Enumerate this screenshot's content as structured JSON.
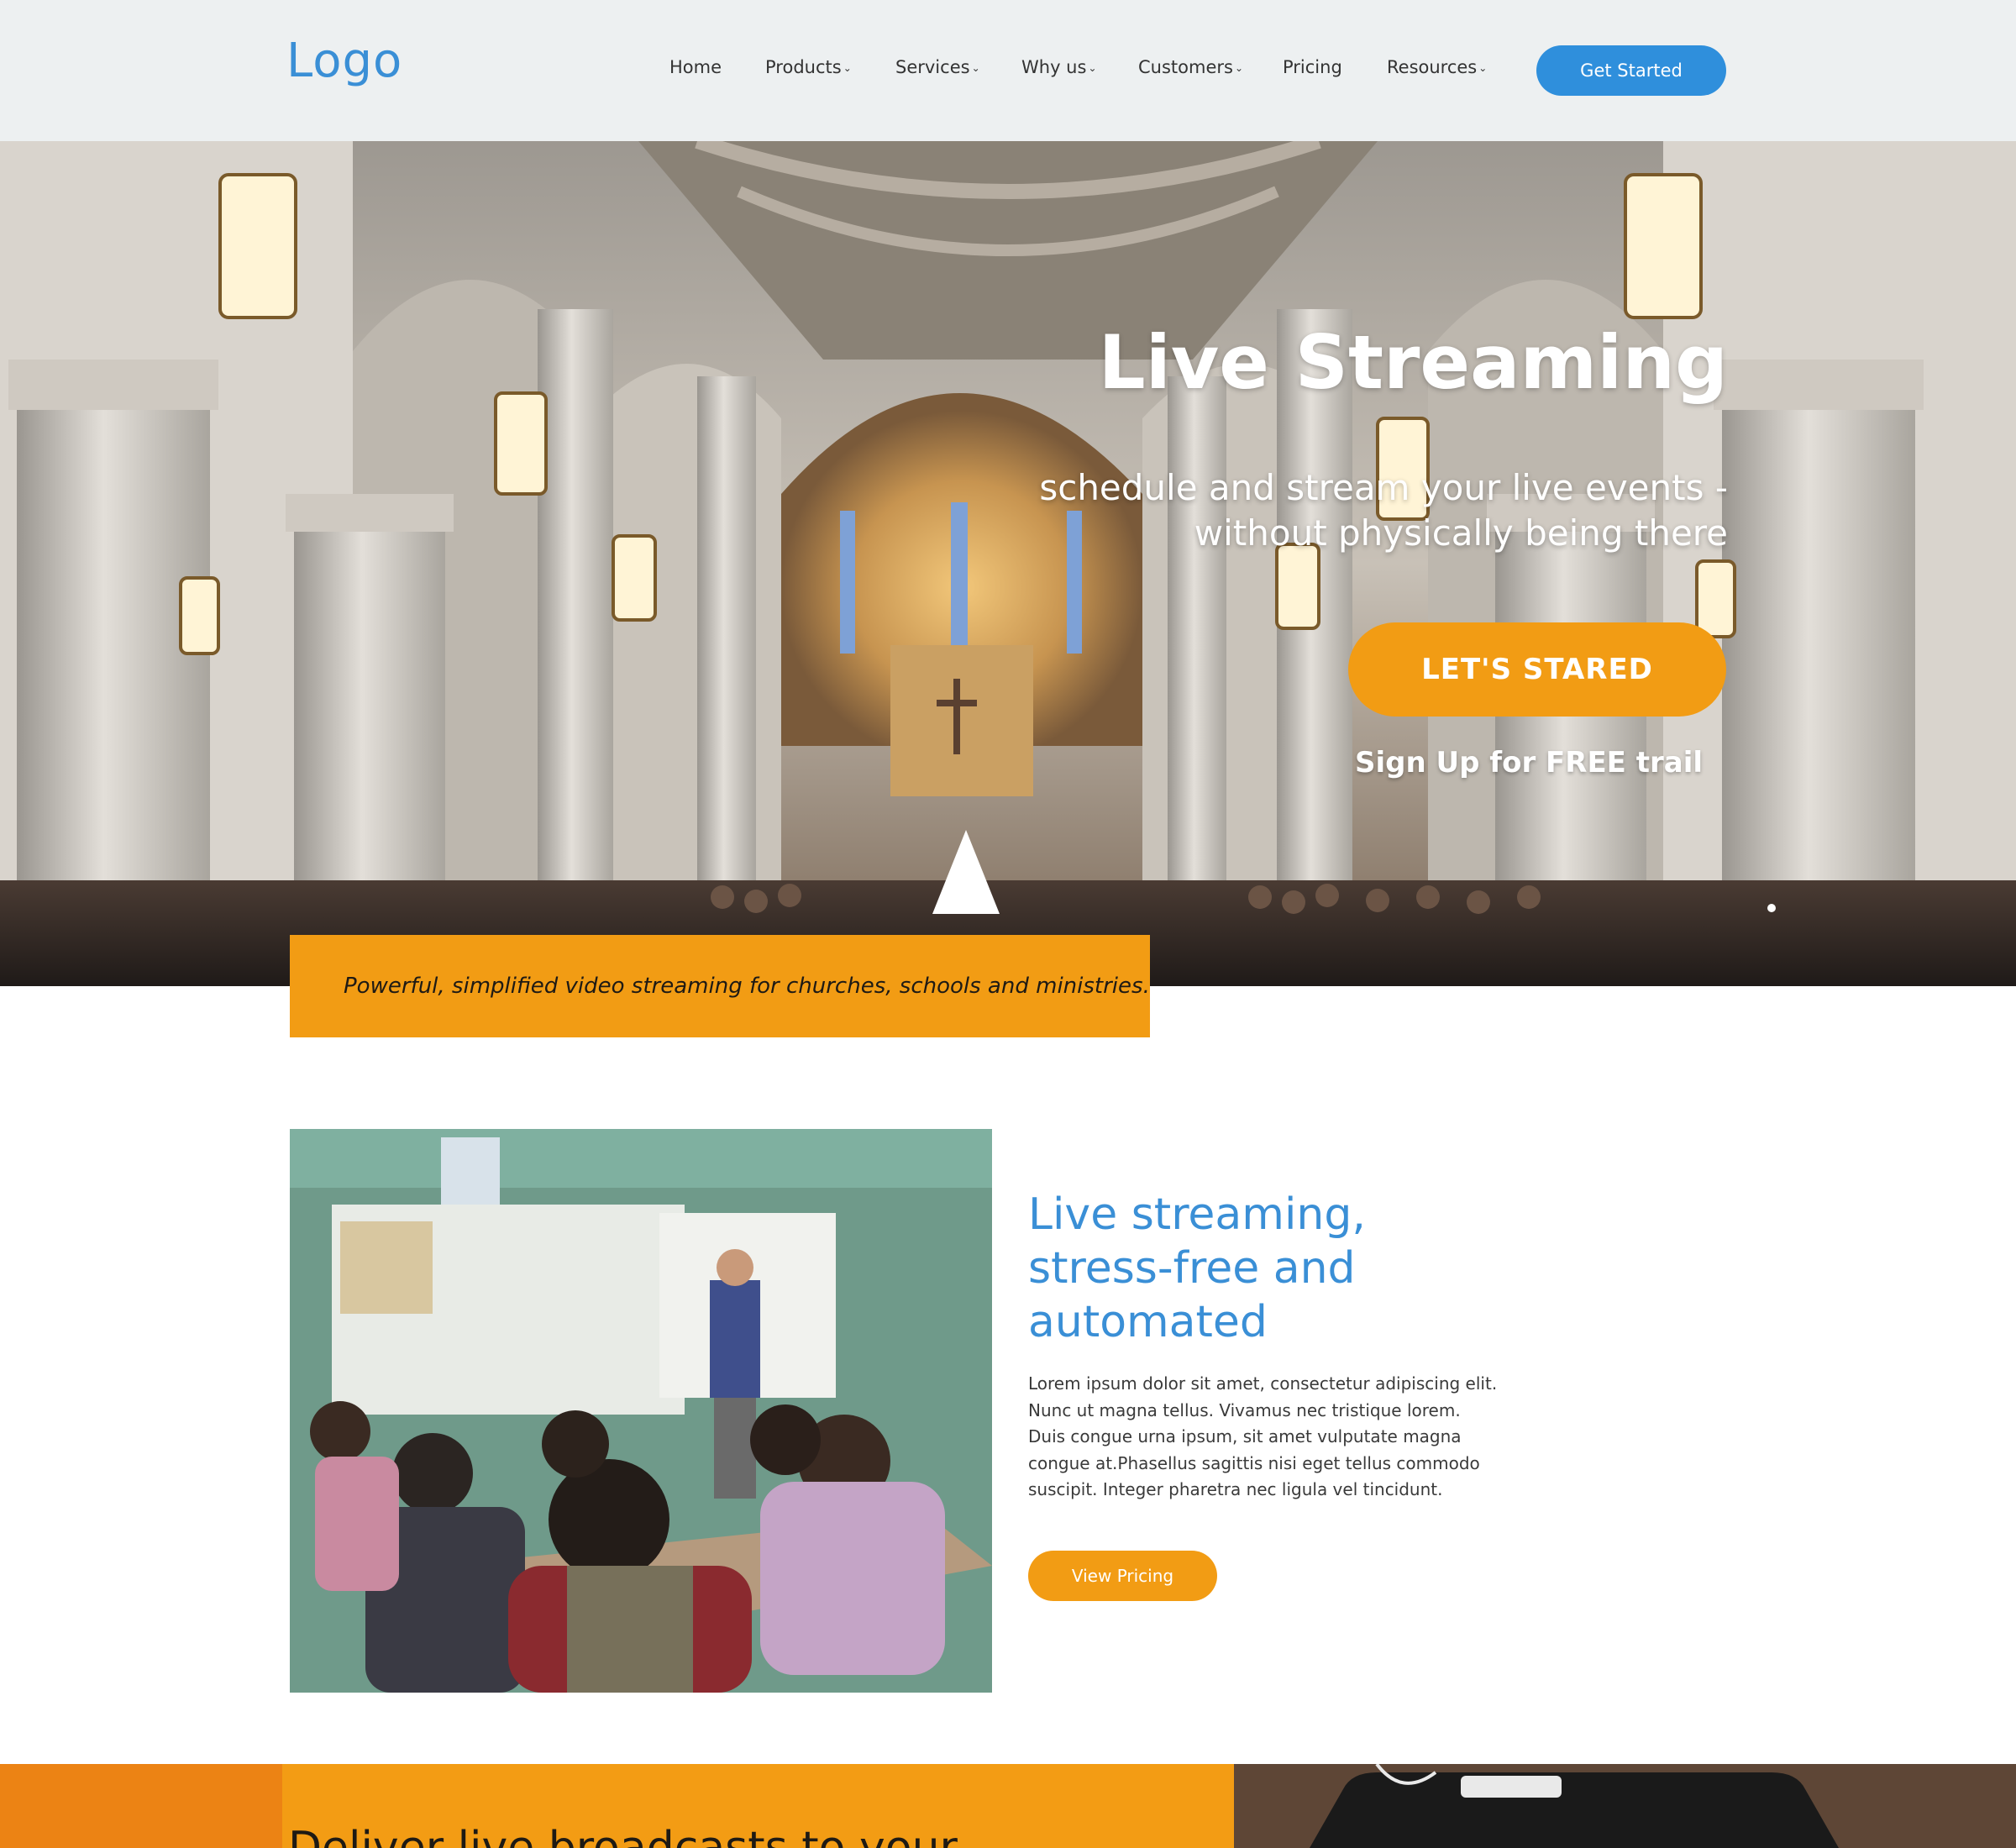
{
  "header": {
    "logo": "Logo",
    "nav": [
      {
        "label": "Home",
        "dropdown": false
      },
      {
        "label": "Products",
        "dropdown": true
      },
      {
        "label": "Services",
        "dropdown": true
      },
      {
        "label": "Why us",
        "dropdown": true
      },
      {
        "label": "Customers",
        "dropdown": true
      },
      {
        "label": "Pricing",
        "dropdown": false
      },
      {
        "label": "Resources",
        "dropdown": true
      }
    ],
    "cta_label": "Get Started",
    "chevron_glyph": "⌄"
  },
  "hero": {
    "title": "Live Streaming",
    "subtitle": "schedule and stream your live events - without physically being there",
    "cta_label": "LET'S STARED",
    "signup_text": "Sign Up for FREE trail",
    "tagline": "Powerful, simplified video streaming for churches, schools and ministries."
  },
  "feature": {
    "title": "Live streaming, stress-free and automated",
    "body": "Lorem ipsum dolor sit amet, consectetur adipiscing elit. Nunc ut magna tellus. Vivamus nec tristique lorem. Duis congue urna ipsum, sit amet vulputate magna congue at.Phasellus sagittis nisi eget tellus commodo suscipit. Integer pharetra nec ligula vel tincidunt.",
    "cta_label": "View Pricing"
  },
  "band": {
    "heading": "Deliver live broadcasts to your"
  },
  "colors": {
    "brand_blue": "#2f8fdc",
    "accent_orange": "#f29c14",
    "header_bg": "#edf0f1"
  }
}
